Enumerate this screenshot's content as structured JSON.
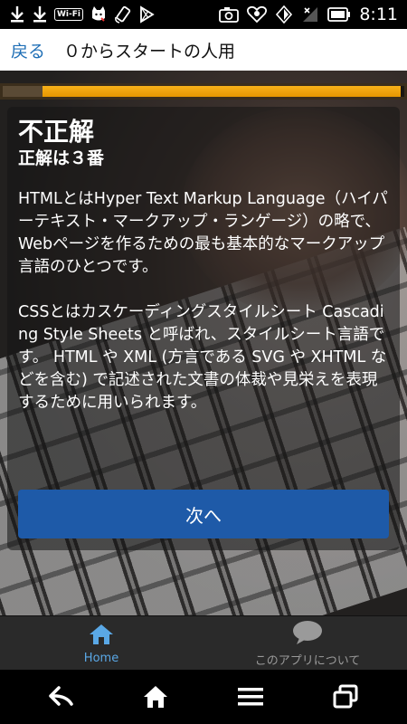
{
  "status_bar": {
    "wifi_badge": "Wi-Fi",
    "time": "8:11",
    "icons": [
      "download-icon",
      "download-icon",
      "wifi-badge",
      "cat-icon",
      "rotate-icon",
      "play-store-icon",
      "camera-icon",
      "heart-icon",
      "signal-icon",
      "battery-icon"
    ]
  },
  "header": {
    "back_label": "戻る",
    "title": "０からスタートの人用"
  },
  "progress": {
    "fraction": 0.99,
    "completed_fraction": 0.1,
    "fill_color": "#f0a010"
  },
  "card": {
    "result": "不正解",
    "answer": "正解は３番",
    "explanation": "HTMLとはHyper Text Markup Language（ハイパーテキスト・マークアップ・ランゲージ）の略で、Webページを作るための最も基本的なマークアップ言語のひとつです。\n\nCSSとはカスケーディングスタイルシート Cascading Style Sheets と呼ばれ、スタイルシート言語です。 HTML や XML (方言である SVG や XHTML などを含む) で記述された文書の体裁や見栄えを表現するために用いられます。",
    "next_label": "次へ"
  },
  "tabbar": {
    "home_label": "Home",
    "about_label": "このアプリについて"
  },
  "colors": {
    "accent": "#1f6fb6",
    "button": "#1e5aa8",
    "home_tab": "#5aa8e6"
  }
}
